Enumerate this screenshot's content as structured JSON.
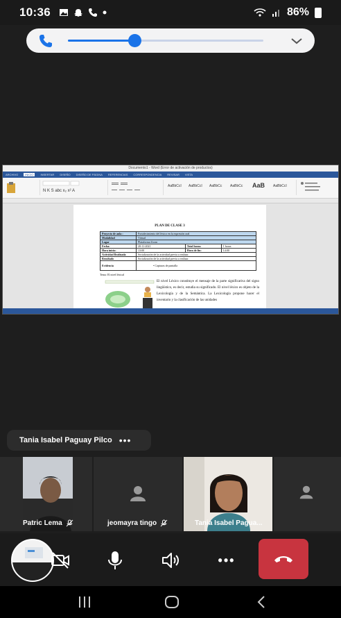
{
  "status_bar": {
    "time": "10:36",
    "battery": "86%",
    "icons": [
      "gallery-icon",
      "snapchat-icon",
      "call-icon",
      "dot-icon",
      "wifi-icon",
      "signal-icon",
      "battery-icon"
    ]
  },
  "call_banner": {
    "volume_fraction": 0.34,
    "accent": "#1a73e8"
  },
  "shared_screen": {
    "window_title": "Documento1 - Word (Error de activación de productos)",
    "tabs": [
      "ARCHIVO",
      "INICIO",
      "INSERTAR",
      "DISEÑO",
      "DISEÑO DE PÁGINA",
      "REFERENCIAS",
      "CORRESPONDENCIA",
      "REVISAR",
      "VISTA"
    ],
    "document": {
      "title": "PLAN DE CLASE 3",
      "rows": [
        {
          "k": "Proyecto de aula :",
          "v": "Fortalecimiento del léxico en la expresión oral"
        },
        {
          "k": "Modalidad",
          "v": "Virtual"
        },
        {
          "k": "Lugar",
          "v": "Plataforma Zoom"
        },
        {
          "k": "Fecha:",
          "v": "20-11-2021",
          "k2": "Total horas:",
          "v2": "1 horas"
        },
        {
          "k": "Hora inicio:",
          "v": "13:00",
          "k2": "Hora de fin:",
          "v2": "14:00"
        },
        {
          "k": "Actividad Realizada",
          "v": "Socialización de la actividad previa a realizar."
        },
        {
          "k": "Resultado",
          "v": "Socialización de la actividad previa a realizar."
        },
        {
          "k": "Evidencia",
          "v": "•  Capturas de pantalla"
        }
      ],
      "tema": "Tema: El nivel léxical",
      "paragraph": "El nivel Léxico constituye el mensaje de la parte significativa del signo lingüístico, es decir, estudia su significado. El nivel léxico es objeto de la Lexicología y de la Semántica. La Lexicología propone hacer el inventario y la clasificación de las unidades"
    }
  },
  "speaker": {
    "name": "Tania Isabel Paguay Pilco",
    "more_label": "•••"
  },
  "participants": [
    {
      "name": "Patric Lema",
      "muted": true,
      "video": true
    },
    {
      "name": "jeomayra tingo",
      "muted": true,
      "video": false
    },
    {
      "name": "Tania Isabel Pagua...",
      "muted": false,
      "video": true
    },
    {
      "name": "",
      "muted": false,
      "video": false
    }
  ],
  "controls": {
    "more_label": "•••",
    "hangup_color": "#c8343f"
  }
}
